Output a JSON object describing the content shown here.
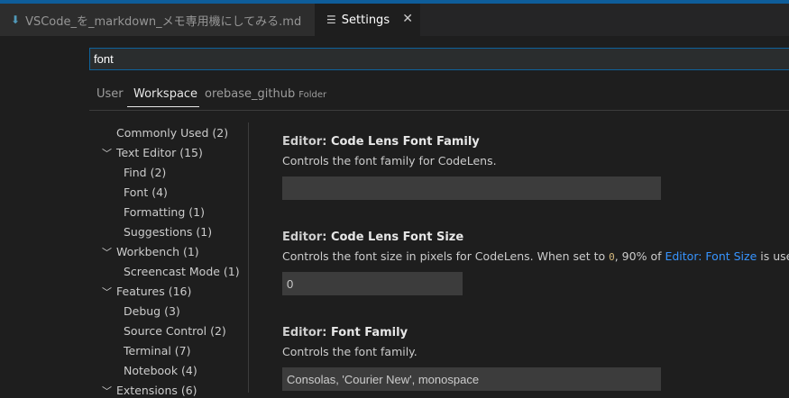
{
  "tabs": [
    {
      "label": "VSCode_を_markdown_メモ専用機にしてみる.md",
      "icon": "markdown-icon"
    },
    {
      "label": "Settings",
      "icon": "settings-icon",
      "close": "✕"
    }
  ],
  "search": {
    "value": "font"
  },
  "scopes": {
    "user": "User",
    "workspace": "Workspace",
    "folder": "orebase_github",
    "folder_tag": "Folder"
  },
  "toc": [
    {
      "label": "Commonly Used (2)",
      "expandable": false,
      "level": 0
    },
    {
      "label": "Text Editor (15)",
      "expandable": true,
      "level": 0
    },
    {
      "label": "Find (2)",
      "expandable": false,
      "level": 1
    },
    {
      "label": "Font (4)",
      "expandable": false,
      "level": 1
    },
    {
      "label": "Formatting (1)",
      "expandable": false,
      "level": 1
    },
    {
      "label": "Suggestions (1)",
      "expandable": false,
      "level": 1
    },
    {
      "label": "Workbench (1)",
      "expandable": true,
      "level": 0
    },
    {
      "label": "Screencast Mode (1)",
      "expandable": false,
      "level": 1
    },
    {
      "label": "Features (16)",
      "expandable": true,
      "level": 0
    },
    {
      "label": "Debug (3)",
      "expandable": false,
      "level": 1
    },
    {
      "label": "Source Control (2)",
      "expandable": false,
      "level": 1
    },
    {
      "label": "Terminal (7)",
      "expandable": false,
      "level": 1
    },
    {
      "label": "Notebook (4)",
      "expandable": false,
      "level": 1
    },
    {
      "label": "Extensions (6)",
      "expandable": true,
      "level": 0
    }
  ],
  "settings": [
    {
      "category": "Editor: ",
      "name": "Code Lens Font Family",
      "description": "Controls the font family for CodeLens.",
      "value": ""
    },
    {
      "category": "Editor: ",
      "name": "Code Lens Font Size",
      "desc_before": "Controls the font size in pixels for CodeLens. When set to ",
      "desc_code": "0",
      "desc_middle": ", 90% of ",
      "desc_link": "Editor: Font Size",
      "desc_after": " is used.",
      "value": "0"
    },
    {
      "category": "Editor: ",
      "name": "Font Family",
      "description": "Controls the font family.",
      "value": "Consolas, 'Courier New', monospace"
    }
  ]
}
